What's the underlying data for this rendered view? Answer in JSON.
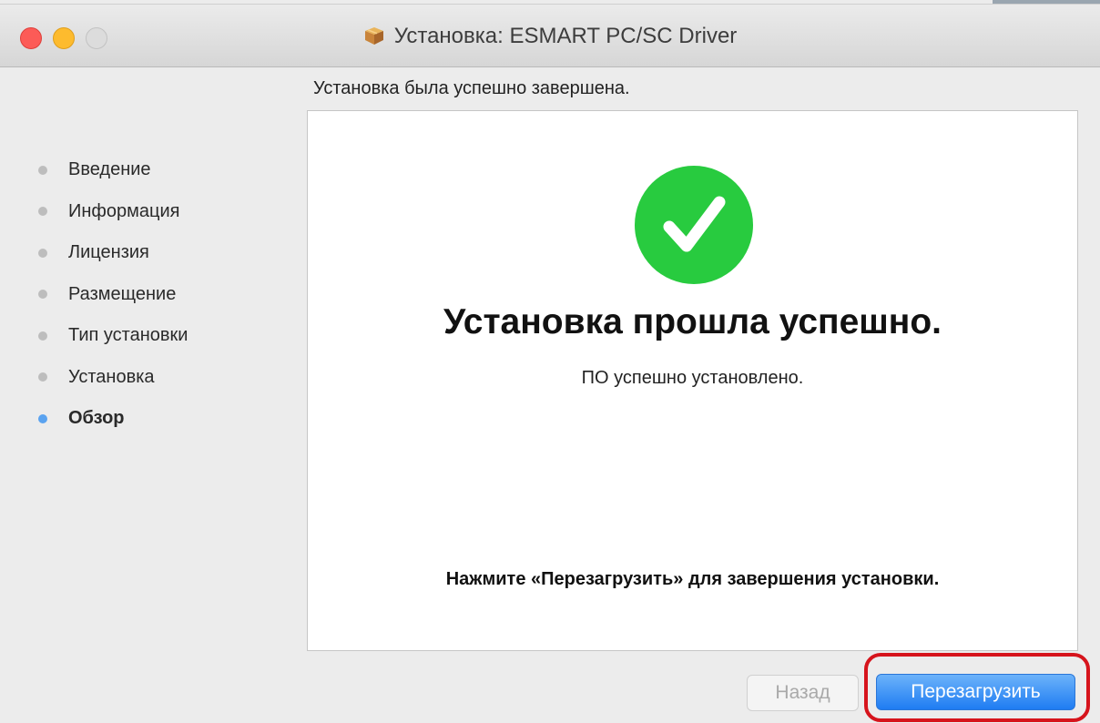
{
  "window": {
    "title": "Установка: ESMART PC/SC Driver",
    "buttons": [
      "close",
      "minimize",
      "zoom"
    ],
    "title_icon": "package-icon"
  },
  "heading": "Установка была успешно завершена.",
  "steps": [
    {
      "label": "Введение",
      "active": false
    },
    {
      "label": "Информация",
      "active": false
    },
    {
      "label": "Лицензия",
      "active": false
    },
    {
      "label": "Размещение",
      "active": false
    },
    {
      "label": "Тип установки",
      "active": false
    },
    {
      "label": "Установка",
      "active": false
    },
    {
      "label": "Обзор",
      "active": true
    }
  ],
  "panel": {
    "status_icon": "checkmark-icon",
    "title": "Установка прошла успешно.",
    "subtitle": "ПО успешно установлено.",
    "note": "Нажмите «Перезагрузить» для завершения установки."
  },
  "buttons": {
    "back_label": "Назад",
    "back_enabled": false,
    "restart_label": "Перезагрузить"
  },
  "colors": {
    "success_green": "#28cb3f",
    "accent_blue": "#1f7cf2",
    "active_step_dot": "#5aa3f0",
    "highlight_red": "#d6141c"
  }
}
